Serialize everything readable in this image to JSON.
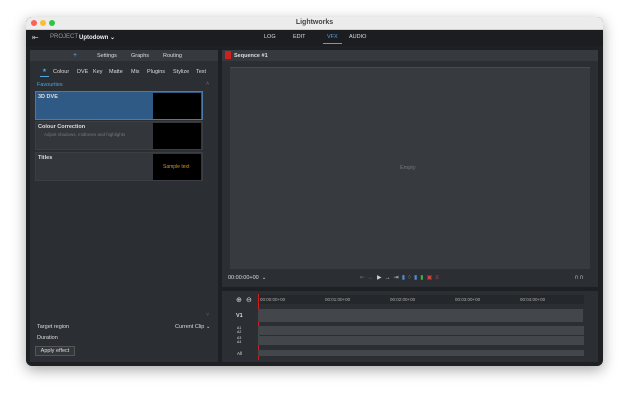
{
  "window": {
    "title": "Lightworks"
  },
  "topbar": {
    "project_label": "PROJECT",
    "project_name": "Uptodown",
    "tabs": [
      {
        "label": "LOG"
      },
      {
        "label": "EDIT"
      },
      {
        "label": "VFX",
        "active": true
      },
      {
        "label": "AUDIO"
      }
    ]
  },
  "left_panel": {
    "tabs": [
      {
        "label": "+"
      },
      {
        "label": "Settings"
      },
      {
        "label": "Graphs"
      },
      {
        "label": "Routing"
      }
    ],
    "categories": [
      {
        "label": "★"
      },
      {
        "label": "Colour"
      },
      {
        "label": "DVE"
      },
      {
        "label": "Key"
      },
      {
        "label": "Matte"
      },
      {
        "label": "Mix"
      },
      {
        "label": "Plugins"
      },
      {
        "label": "Stylize"
      },
      {
        "label": "Text"
      }
    ],
    "section": "Favourites",
    "effects": [
      {
        "name": "3D DVE",
        "description": "",
        "thumb_text": ""
      },
      {
        "name": "Colour Correction",
        "description": "Adjust shadows, midtones and highlights",
        "thumb_text": ""
      },
      {
        "name": "Titles",
        "description": "",
        "thumb_text": "Sample text"
      }
    ],
    "target_region_label": "Target region",
    "target_region_value": "Current Clip",
    "duration_label": "Duration",
    "apply_button": "Apply effect"
  },
  "viewer": {
    "title": "Sequence #1",
    "empty_text": "Empty",
    "timecode": "00:00:00+00"
  },
  "timeline": {
    "ticks": [
      "00:00:00+00",
      "00:01:00+00",
      "00:02:00+00",
      "00:03:00+00",
      "00:04:00+00"
    ],
    "tracks": [
      "V1",
      "A1 A2",
      "A3 A4",
      "All"
    ]
  },
  "colors": {
    "accent": "#4aa8e0",
    "selected": "#2f5a85",
    "playhead": "#d01f1f",
    "sample_text": "#d4961e"
  }
}
